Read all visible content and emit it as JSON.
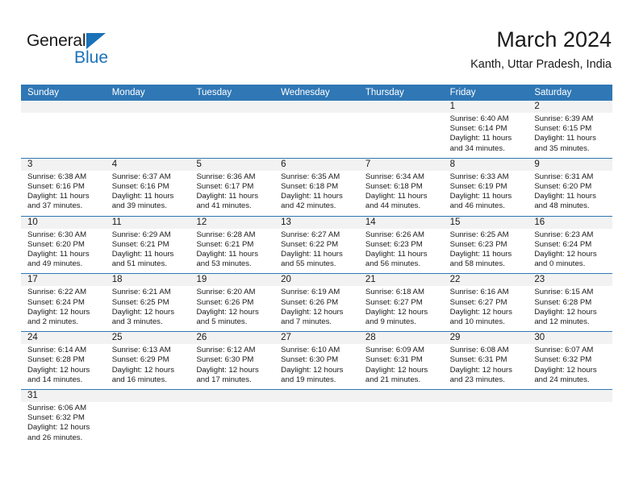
{
  "brand": {
    "name_top": "General",
    "name_bottom": "Blue",
    "accent_color": "#1b72b8"
  },
  "header": {
    "title": "March 2024",
    "subtitle": "Kanth, Uttar Pradesh, India"
  },
  "theme": {
    "header_blue": "#2f77b5",
    "number_band_gray": "#f2f2f2",
    "text_color": "#1a1a1a"
  },
  "calendar": {
    "weekdays": [
      "Sunday",
      "Monday",
      "Tuesday",
      "Wednesday",
      "Thursday",
      "Friday",
      "Saturday"
    ],
    "weeks": [
      [
        {
          "day": "",
          "lines": []
        },
        {
          "day": "",
          "lines": []
        },
        {
          "day": "",
          "lines": []
        },
        {
          "day": "",
          "lines": []
        },
        {
          "day": "",
          "lines": []
        },
        {
          "day": "1",
          "lines": [
            "Sunrise: 6:40 AM",
            "Sunset: 6:14 PM",
            "Daylight: 11 hours",
            "and 34 minutes."
          ]
        },
        {
          "day": "2",
          "lines": [
            "Sunrise: 6:39 AM",
            "Sunset: 6:15 PM",
            "Daylight: 11 hours",
            "and 35 minutes."
          ]
        }
      ],
      [
        {
          "day": "3",
          "lines": [
            "Sunrise: 6:38 AM",
            "Sunset: 6:16 PM",
            "Daylight: 11 hours",
            "and 37 minutes."
          ]
        },
        {
          "day": "4",
          "lines": [
            "Sunrise: 6:37 AM",
            "Sunset: 6:16 PM",
            "Daylight: 11 hours",
            "and 39 minutes."
          ]
        },
        {
          "day": "5",
          "lines": [
            "Sunrise: 6:36 AM",
            "Sunset: 6:17 PM",
            "Daylight: 11 hours",
            "and 41 minutes."
          ]
        },
        {
          "day": "6",
          "lines": [
            "Sunrise: 6:35 AM",
            "Sunset: 6:18 PM",
            "Daylight: 11 hours",
            "and 42 minutes."
          ]
        },
        {
          "day": "7",
          "lines": [
            "Sunrise: 6:34 AM",
            "Sunset: 6:18 PM",
            "Daylight: 11 hours",
            "and 44 minutes."
          ]
        },
        {
          "day": "8",
          "lines": [
            "Sunrise: 6:33 AM",
            "Sunset: 6:19 PM",
            "Daylight: 11 hours",
            "and 46 minutes."
          ]
        },
        {
          "day": "9",
          "lines": [
            "Sunrise: 6:31 AM",
            "Sunset: 6:20 PM",
            "Daylight: 11 hours",
            "and 48 minutes."
          ]
        }
      ],
      [
        {
          "day": "10",
          "lines": [
            "Sunrise: 6:30 AM",
            "Sunset: 6:20 PM",
            "Daylight: 11 hours",
            "and 49 minutes."
          ]
        },
        {
          "day": "11",
          "lines": [
            "Sunrise: 6:29 AM",
            "Sunset: 6:21 PM",
            "Daylight: 11 hours",
            "and 51 minutes."
          ]
        },
        {
          "day": "12",
          "lines": [
            "Sunrise: 6:28 AM",
            "Sunset: 6:21 PM",
            "Daylight: 11 hours",
            "and 53 minutes."
          ]
        },
        {
          "day": "13",
          "lines": [
            "Sunrise: 6:27 AM",
            "Sunset: 6:22 PM",
            "Daylight: 11 hours",
            "and 55 minutes."
          ]
        },
        {
          "day": "14",
          "lines": [
            "Sunrise: 6:26 AM",
            "Sunset: 6:23 PM",
            "Daylight: 11 hours",
            "and 56 minutes."
          ]
        },
        {
          "day": "15",
          "lines": [
            "Sunrise: 6:25 AM",
            "Sunset: 6:23 PM",
            "Daylight: 11 hours",
            "and 58 minutes."
          ]
        },
        {
          "day": "16",
          "lines": [
            "Sunrise: 6:23 AM",
            "Sunset: 6:24 PM",
            "Daylight: 12 hours",
            "and 0 minutes."
          ]
        }
      ],
      [
        {
          "day": "17",
          "lines": [
            "Sunrise: 6:22 AM",
            "Sunset: 6:24 PM",
            "Daylight: 12 hours",
            "and 2 minutes."
          ]
        },
        {
          "day": "18",
          "lines": [
            "Sunrise: 6:21 AM",
            "Sunset: 6:25 PM",
            "Daylight: 12 hours",
            "and 3 minutes."
          ]
        },
        {
          "day": "19",
          "lines": [
            "Sunrise: 6:20 AM",
            "Sunset: 6:26 PM",
            "Daylight: 12 hours",
            "and 5 minutes."
          ]
        },
        {
          "day": "20",
          "lines": [
            "Sunrise: 6:19 AM",
            "Sunset: 6:26 PM",
            "Daylight: 12 hours",
            "and 7 minutes."
          ]
        },
        {
          "day": "21",
          "lines": [
            "Sunrise: 6:18 AM",
            "Sunset: 6:27 PM",
            "Daylight: 12 hours",
            "and 9 minutes."
          ]
        },
        {
          "day": "22",
          "lines": [
            "Sunrise: 6:16 AM",
            "Sunset: 6:27 PM",
            "Daylight: 12 hours",
            "and 10 minutes."
          ]
        },
        {
          "day": "23",
          "lines": [
            "Sunrise: 6:15 AM",
            "Sunset: 6:28 PM",
            "Daylight: 12 hours",
            "and 12 minutes."
          ]
        }
      ],
      [
        {
          "day": "24",
          "lines": [
            "Sunrise: 6:14 AM",
            "Sunset: 6:28 PM",
            "Daylight: 12 hours",
            "and 14 minutes."
          ]
        },
        {
          "day": "25",
          "lines": [
            "Sunrise: 6:13 AM",
            "Sunset: 6:29 PM",
            "Daylight: 12 hours",
            "and 16 minutes."
          ]
        },
        {
          "day": "26",
          "lines": [
            "Sunrise: 6:12 AM",
            "Sunset: 6:30 PM",
            "Daylight: 12 hours",
            "and 17 minutes."
          ]
        },
        {
          "day": "27",
          "lines": [
            "Sunrise: 6:10 AM",
            "Sunset: 6:30 PM",
            "Daylight: 12 hours",
            "and 19 minutes."
          ]
        },
        {
          "day": "28",
          "lines": [
            "Sunrise: 6:09 AM",
            "Sunset: 6:31 PM",
            "Daylight: 12 hours",
            "and 21 minutes."
          ]
        },
        {
          "day": "29",
          "lines": [
            "Sunrise: 6:08 AM",
            "Sunset: 6:31 PM",
            "Daylight: 12 hours",
            "and 23 minutes."
          ]
        },
        {
          "day": "30",
          "lines": [
            "Sunrise: 6:07 AM",
            "Sunset: 6:32 PM",
            "Daylight: 12 hours",
            "and 24 minutes."
          ]
        }
      ],
      [
        {
          "day": "31",
          "lines": [
            "Sunrise: 6:06 AM",
            "Sunset: 6:32 PM",
            "Daylight: 12 hours",
            "and 26 minutes."
          ]
        },
        {
          "day": "",
          "lines": []
        },
        {
          "day": "",
          "lines": []
        },
        {
          "day": "",
          "lines": []
        },
        {
          "day": "",
          "lines": []
        },
        {
          "day": "",
          "lines": []
        },
        {
          "day": "",
          "lines": []
        }
      ]
    ]
  }
}
